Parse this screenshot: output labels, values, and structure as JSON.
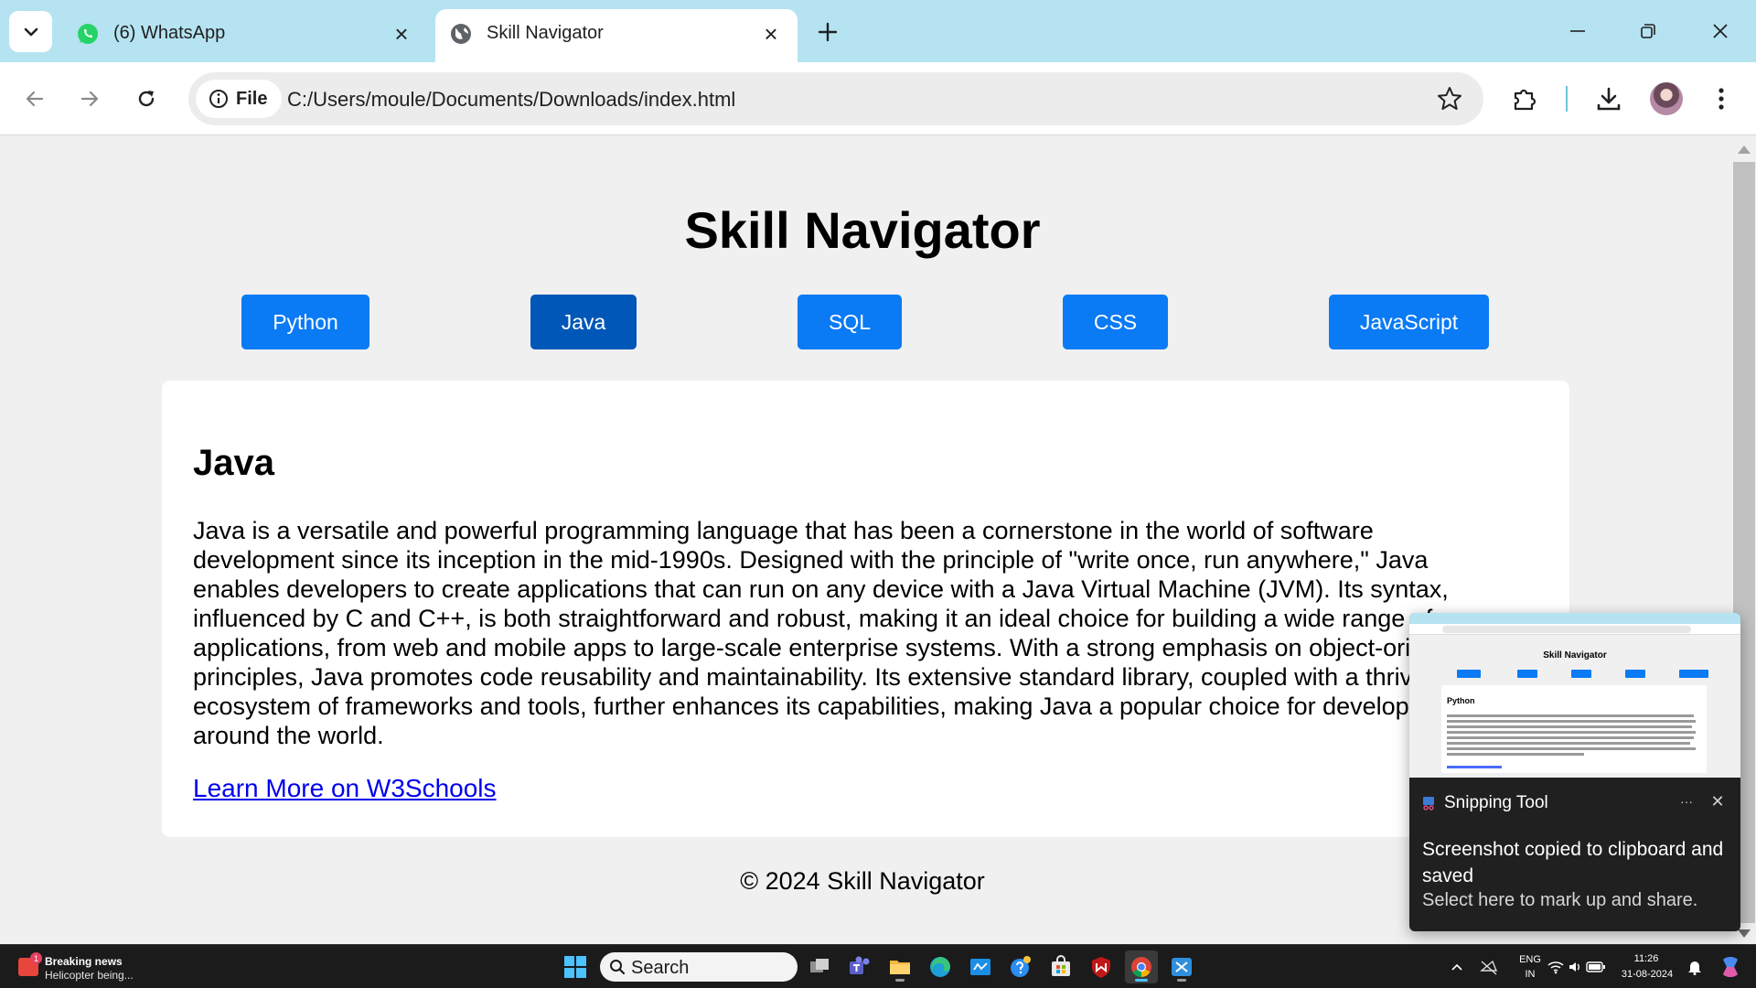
{
  "browser": {
    "tabs": [
      {
        "title": "(6) WhatsApp",
        "icon": "whatsapp-icon",
        "active": false
      },
      {
        "title": "Skill Navigator",
        "icon": "globe-icon",
        "active": true
      }
    ],
    "site_chip_label": "File",
    "url": "C:/Users/moule/Documents/Downloads/index.html"
  },
  "page": {
    "title": "Skill Navigator",
    "skills": [
      "Python",
      "Java",
      "SQL",
      "CSS",
      "JavaScript"
    ],
    "active_skill": "Java",
    "card": {
      "heading": "Java",
      "body": "Java is a versatile and powerful programming language that has been a cornerstone in the world of software development since its inception in the mid-1990s. Designed with the principle of \"write once, run anywhere,\" Java enables developers to create applications that can run on any device with a Java Virtual Machine (JVM). Its syntax, influenced by C and C++, is both straightforward and robust, making it an ideal choice for building a wide range of applications, from web and mobile apps to large-scale enterprise systems. With a strong emphasis on object-oriented principles, Java promotes code reusability and maintainability. Its extensive standard library, coupled with a thriving ecosystem of frameworks and tools, further enhances its capabilities, making Java a popular choice for developers around the world.",
      "link_label": "Learn More on W3Schools"
    },
    "footer": "© 2024 Skill Navigator"
  },
  "toast": {
    "app_name": "Snipping Tool",
    "more_label": "···",
    "close_label": "✕",
    "message": "Screenshot copied to clipboard and saved",
    "sub": "Select here to mark up and share.",
    "preview": {
      "title": "Skill Navigator",
      "heading": "Python"
    }
  },
  "taskbar": {
    "news_title": "Breaking news",
    "news_sub": "Helicopter being...",
    "news_badge": "1",
    "search_placeholder": "Search",
    "lang_top": "ENG",
    "lang_bottom": "IN",
    "time": "11:26",
    "date": "31-08-2024"
  },
  "colors": {
    "tabstrip": "#b5e3f1",
    "skill_button": "#0a7af5",
    "skill_button_active": "#0057b8",
    "link": "#0000ee"
  }
}
